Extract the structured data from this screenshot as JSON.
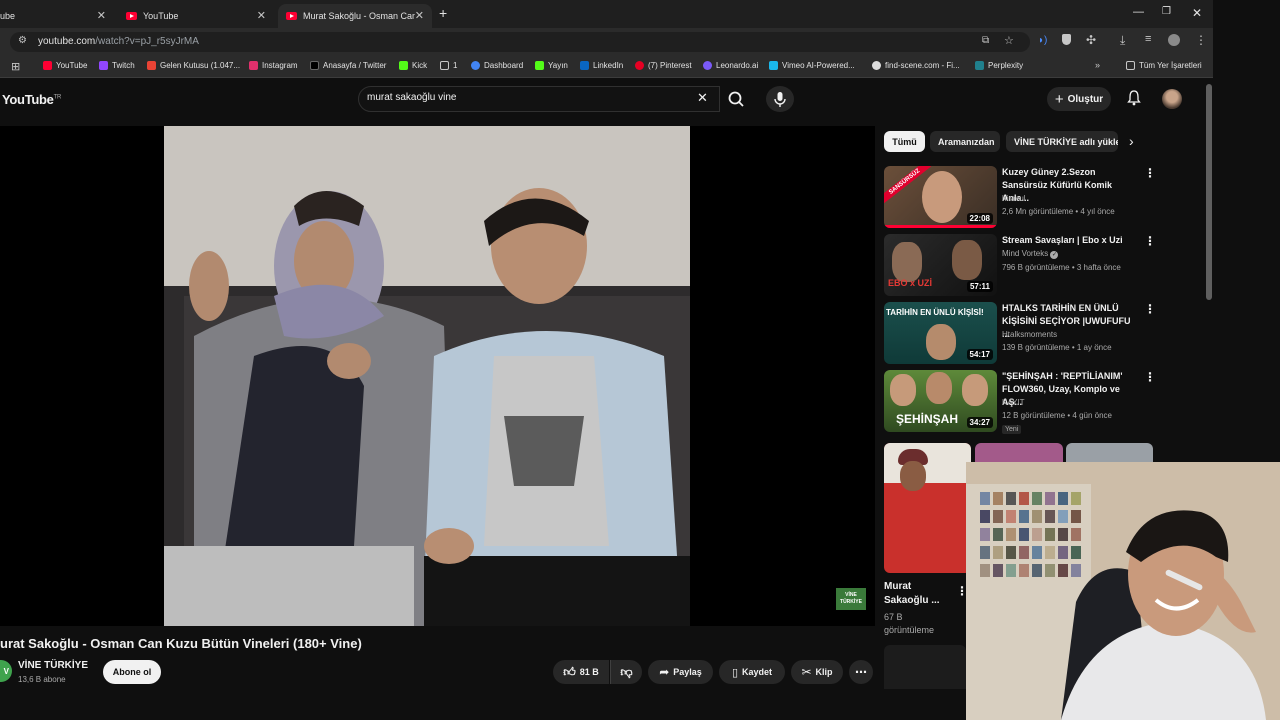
{
  "browser": {
    "tabs": [
      {
        "label": "ube"
      },
      {
        "label": "YouTube"
      },
      {
        "label": "Murat Sakoğlu - Osman Can Ku"
      }
    ],
    "url_host": "youtube.com",
    "url_path": "/watch?v=pJ_r5syJrMA",
    "bookmarks": [
      {
        "label": "YouTube",
        "color": "#ff0033"
      },
      {
        "label": "Twitch",
        "color": "#9146ff"
      },
      {
        "label": "Gelen Kutusu (1.047...",
        "color": "#ea4335"
      },
      {
        "label": "Instagram",
        "color": "#e1306c"
      },
      {
        "label": "Anasayfa / Twitter",
        "color": "#000000"
      },
      {
        "label": "Kick",
        "color": "#53fc18"
      },
      {
        "label": "1",
        "color": "#8a8a8a"
      },
      {
        "label": "Dashboard",
        "color": "#4285f4"
      },
      {
        "label": "Yayın",
        "color": "#53fc18"
      },
      {
        "label": "LinkedIn",
        "color": "#0a66c2"
      },
      {
        "label": "(7) Pinterest",
        "color": "#e60023"
      },
      {
        "label": "Leonardo.ai",
        "color": "#7a5af8"
      },
      {
        "label": "Vimeo AI-Powered...",
        "color": "#1ab7ea"
      },
      {
        "label": "find-scene.com - Fi...",
        "color": "#dddddd"
      },
      {
        "label": "Perplexity",
        "color": "#20808d"
      }
    ],
    "all_bookmarks_label": "Tüm Yer İşaretleri"
  },
  "youtube": {
    "logo_text": "YouTube",
    "region": "TR",
    "search_value": "murat sakaoğlu vine",
    "create_label": "Oluştur",
    "video_title": "urat Sakoğlu - Osman Can Kuzu Bütün Vineleri (180+ Vine)",
    "channel_name": "VİNE TÜRKİYE",
    "subscribers": "13,6 B abone",
    "subscribe_label": "Abone ol",
    "likes": "81 B",
    "share_label": "Paylaş",
    "save_label": "Kaydet",
    "clip_label": "Klip",
    "watermark": "VİNE TÜRKİYE",
    "chips": [
      "Tümü",
      "Aramanızdan",
      "VİNE TÜRKİYE adlı yükle"
    ],
    "recommendations": [
      {
        "title": "Kuzey Güney 2.Sezon Sansürsüz Küfürlü Komik Anla...",
        "channel": "hiravul",
        "meta": "2,6 Mn görüntüleme • 4 yıl önce",
        "duration": "22:08",
        "thumb_text": "SANSÜRSÜZ",
        "thumb_color": "#4a3a2a"
      },
      {
        "title": "Stream Savaşları | Ebo x Uzi",
        "channel": "Mind Vorteks",
        "verified": true,
        "meta": "796 B görüntüleme • 3 hafta önce",
        "duration": "57:11",
        "thumb_text": "EBO x UZİ",
        "thumb_color": "#2a2a2a"
      },
      {
        "title": "HTALKS TARİHİN EN ÜNLÜ KİŞİSİNİ SEÇİYOR |UWUFUFU ...",
        "channel": "Htalksmoments",
        "meta": "139 B görüntüleme • 1 ay önce",
        "duration": "54:17",
        "thumb_text": "TARİHİN EN ÜNLÜ KİŞİSİ!",
        "thumb_color": "#1f5f5c"
      },
      {
        "title": "\"ŞEHİNŞAH : 'REPTİLİANIM' FLOW360, Uzay, Komplo ve AŞ...",
        "channel": "KAYIT",
        "meta": "12 B görüntüleme • 4 gün önce",
        "badge": "Yeni",
        "duration": "34:27",
        "thumb_text": "ŞEHİNŞAH",
        "thumb_color": "#3d6b2a"
      }
    ],
    "short": {
      "title": "Murat Sakaoğlu ...",
      "views": "67 B",
      "views_suffix": "görüntüleme"
    }
  }
}
